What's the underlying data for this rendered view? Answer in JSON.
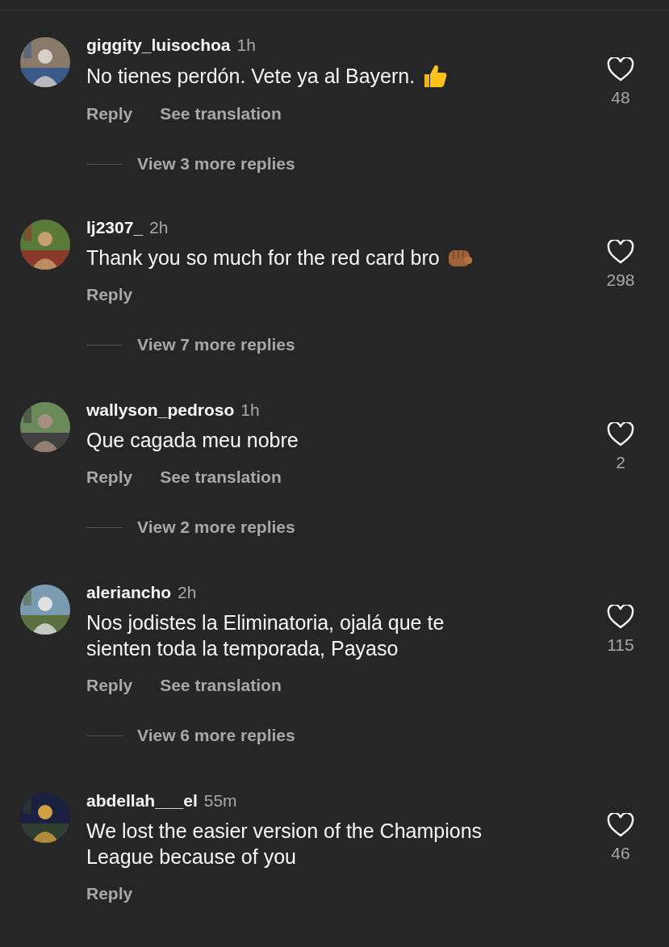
{
  "comments": [
    {
      "username": "giggity_luisochoa",
      "time": "1h",
      "text": "No tienes perdón. Vete ya al Bayern.",
      "kind": "thumbs_up",
      "actions": [
        "Reply",
        "See translation"
      ],
      "likes": "48",
      "liked": false,
      "view_replies": "View 3 more replies"
    },
    {
      "username": "lj2307_",
      "time": "2h",
      "text": "Thank you so much for the red card bro",
      "kind": "fist",
      "actions": [
        "Reply"
      ],
      "likes": "298",
      "liked": false,
      "view_replies": "View 7 more replies"
    },
    {
      "username": "wallyson_pedroso",
      "time": "1h",
      "text": "Que cagada meu nobre",
      "actions": [
        "Reply",
        "See translation"
      ],
      "likes": "2",
      "liked": false,
      "view_replies": "View 2 more replies"
    },
    {
      "username": "aleriancho",
      "time": "2h",
      "text": "Nos jodistes la Eliminatoria, ojalá que te\nsienten toda la temporada, Payaso",
      "actions": [
        "Reply",
        "See translation"
      ],
      "likes": "115",
      "liked": false,
      "view_replies": "View 6 more replies"
    },
    {
      "username": "abdellah___el",
      "time": "55m",
      "text": "We lost the easier version of the Champions\nLeague because of you",
      "actions": [
        "Reply"
      ],
      "likes": "46",
      "liked": false
    }
  ]
}
